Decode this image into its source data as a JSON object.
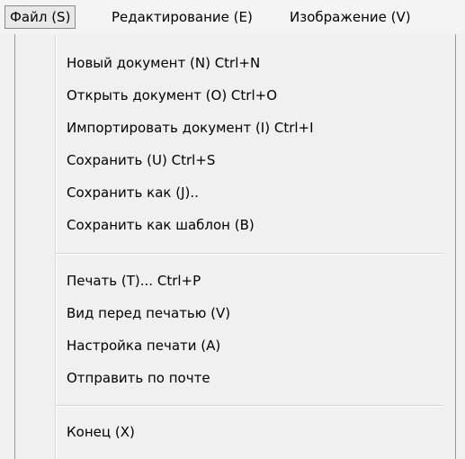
{
  "menubar": {
    "items": [
      {
        "label": "Файл (S)"
      },
      {
        "label": "Редактирование (E)"
      },
      {
        "label": "Изображение (V)"
      }
    ]
  },
  "file_menu": {
    "groups": [
      [
        {
          "label": "Новый документ (N) Ctrl+N"
        },
        {
          "label": "Открыть документ (O) Ctrl+O"
        },
        {
          "label": "Импортировать документ (I) Ctrl+I"
        },
        {
          "label": "Сохранить (U) Ctrl+S"
        },
        {
          "label": "Сохранить как (J).."
        },
        {
          "label": "Сохранить как шаблон (B)"
        }
      ],
      [
        {
          "label": "Печать (T)... Ctrl+P"
        },
        {
          "label": "Вид перед печатью (V)"
        },
        {
          "label": "Настройка печати (A)"
        },
        {
          "label": "Отправить по почте"
        }
      ],
      [
        {
          "label": "Конец (X)"
        }
      ]
    ]
  }
}
